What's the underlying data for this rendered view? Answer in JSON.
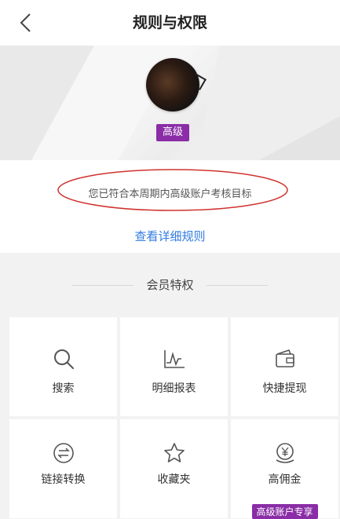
{
  "header": {
    "title": "规则与权限",
    "back_icon": "chevron-left-icon"
  },
  "profile": {
    "level_badge": "高级",
    "badge_color": "#8a2da6"
  },
  "status": {
    "message": "您已符合本周期内高级账户考核目标",
    "highlight_color": "#d0322e",
    "detail_link": "查看详细规则",
    "link_color": "#2f7be0"
  },
  "privileges": {
    "title": "会员特权",
    "items": [
      {
        "label": "搜索",
        "icon": "search-icon"
      },
      {
        "label": "明细报表",
        "icon": "line-chart-icon"
      },
      {
        "label": "快捷提现",
        "icon": "wallet-icon"
      },
      {
        "label": "链接转换",
        "icon": "exchange-icon"
      },
      {
        "label": "收藏夹",
        "icon": "star-icon"
      },
      {
        "label": "高佣金",
        "icon": "yen-coin-icon",
        "tag": "高级账户专享"
      }
    ]
  }
}
